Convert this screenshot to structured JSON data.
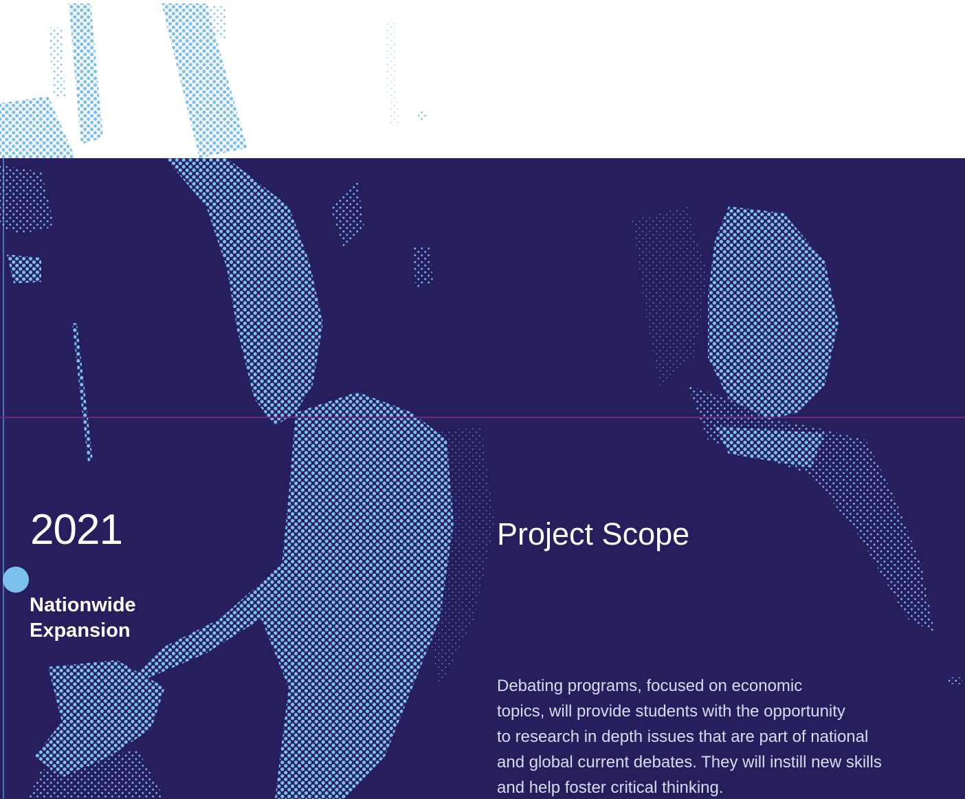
{
  "timeline": {
    "year": "2021",
    "milestone_lines": [
      "Nationwide",
      "Expansion"
    ]
  },
  "project_scope": {
    "title": "Project Scope",
    "body_lines": [
      "Debating programs, focused on economic",
      "topics, will provide students with the opportunity",
      "to research in depth issues that are part of national",
      "and global current debates. They will instill new skills",
      "and help foster critical thinking."
    ]
  },
  "colors": {
    "background_top": "#ffffff",
    "panel": "#271e5e",
    "accent": "#7cc0ee",
    "divider": "#6b2a7c"
  },
  "imagery": {
    "description": "halftone-photo-of-two-students",
    "icons": [
      "timeline-dot-icon"
    ]
  }
}
